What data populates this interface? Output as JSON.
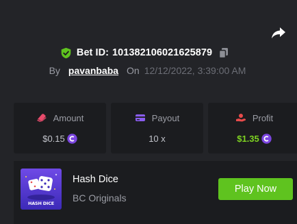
{
  "bet": {
    "id_label": "Bet ID:",
    "id_value": "101382106021625879",
    "by_label": "By",
    "username": "pavanbaba",
    "on_label": "On",
    "date": "12/12/2022, 3:39:00 AM"
  },
  "stats": [
    {
      "label": "Amount",
      "value": "$0.15",
      "icon": "amount-icon",
      "coin": true
    },
    {
      "label": "Payout",
      "value": "10 x",
      "icon": "payout-icon",
      "coin": false
    },
    {
      "label": "Profit",
      "value": "$1.35",
      "icon": "profit-icon",
      "coin": true
    }
  ],
  "game": {
    "thumb_label": "HASH DICE",
    "title": "Hash Dice",
    "subtitle": "BC Originals",
    "play_label": "Play Now"
  },
  "colors": {
    "background": "#232428",
    "panel": "#1b1c1f",
    "accent_green": "#5fc31f",
    "profit_green": "#7ed321",
    "muted_text": "#9a9ca4",
    "shield_green": "#5fc31f",
    "coin_purple": "#7b45e0"
  }
}
